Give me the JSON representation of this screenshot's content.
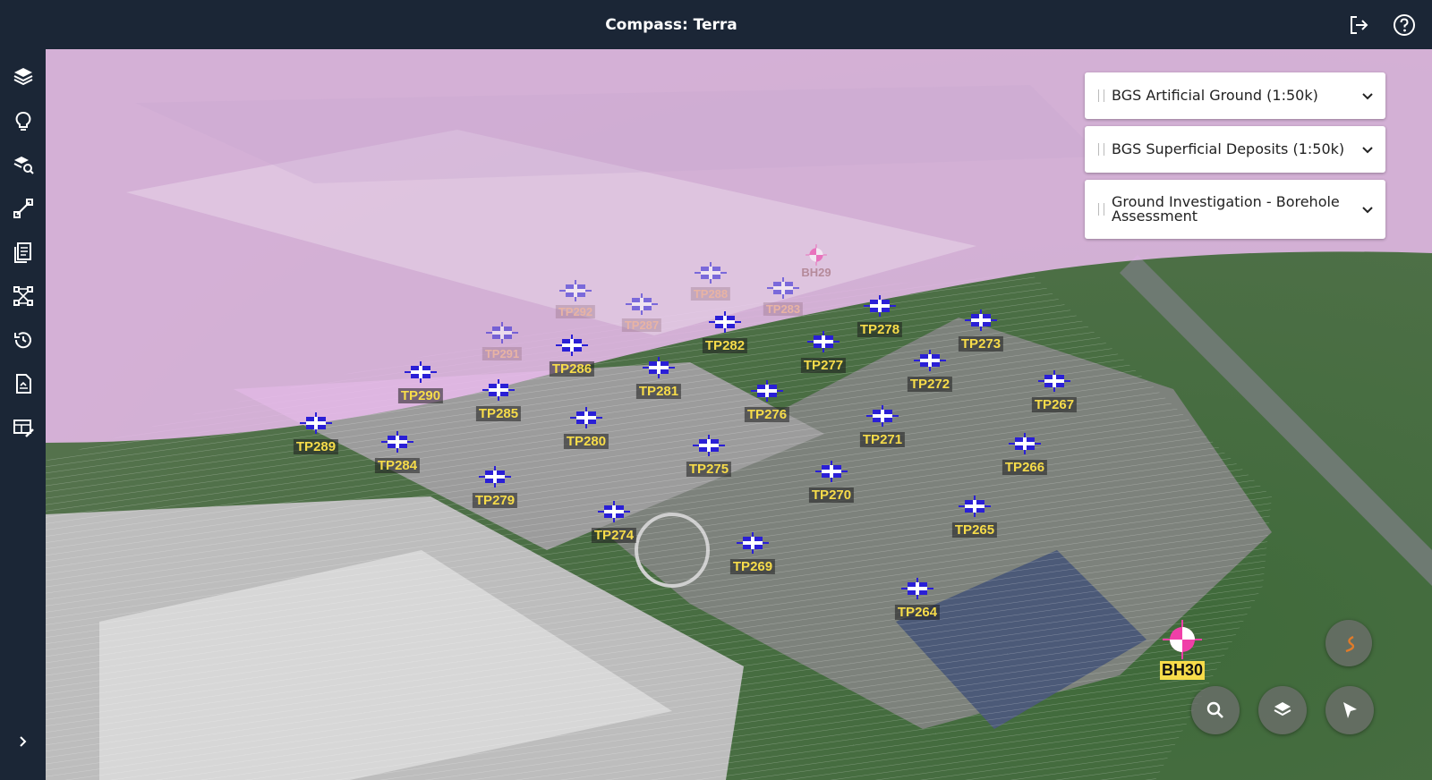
{
  "app": {
    "title": "Compass: Terra"
  },
  "header": {
    "icons": [
      "logout-icon",
      "help-icon"
    ]
  },
  "sidebar": {
    "items": [
      {
        "name": "layers",
        "icon": "layers-icon"
      },
      {
        "name": "insights",
        "icon": "lightbulb-icon"
      },
      {
        "name": "search-area",
        "icon": "search-layers-icon"
      },
      {
        "name": "measure",
        "icon": "ruler-line-icon"
      },
      {
        "name": "documents",
        "icon": "documents-icon"
      },
      {
        "name": "network",
        "icon": "network-icon"
      },
      {
        "name": "history",
        "icon": "history-icon"
      },
      {
        "name": "report",
        "icon": "report-icon"
      },
      {
        "name": "table-edit",
        "icon": "table-edit-icon"
      }
    ],
    "expand_icon": "chevron-right-icon"
  },
  "layers": [
    {
      "title": "BGS Artificial Ground (1:50k)"
    },
    {
      "title": "BGS Superficial Deposits (1:50k)"
    },
    {
      "title": "Ground Investigation - Borehole Assessment"
    }
  ],
  "trial_pits": [
    {
      "label": "TP292",
      "faded": true
    },
    {
      "label": "TP288",
      "faded": true
    },
    {
      "label": "TP283",
      "faded": true
    },
    {
      "label": "TP287",
      "faded": true
    },
    {
      "label": "TP291",
      "faded": true
    },
    {
      "label": "TP286",
      "faded": false
    },
    {
      "label": "TP282",
      "faded": false
    },
    {
      "label": "TP278",
      "faded": false
    },
    {
      "label": "TP273",
      "faded": false
    },
    {
      "label": "TP277",
      "faded": false
    },
    {
      "label": "TP281",
      "faded": false
    },
    {
      "label": "TP290",
      "faded": false
    },
    {
      "label": "TP272",
      "faded": false
    },
    {
      "label": "TP267",
      "faded": false
    },
    {
      "label": "TP285",
      "faded": false
    },
    {
      "label": "TP276",
      "faded": false
    },
    {
      "label": "TP271",
      "faded": false
    },
    {
      "label": "TP289",
      "faded": false
    },
    {
      "label": "TP280",
      "faded": false
    },
    {
      "label": "TP284",
      "faded": false
    },
    {
      "label": "TP275",
      "faded": false
    },
    {
      "label": "TP266",
      "faded": false
    },
    {
      "label": "TP270",
      "faded": false
    },
    {
      "label": "TP279",
      "faded": false
    },
    {
      "label": "TP265",
      "faded": false
    },
    {
      "label": "TP274",
      "faded": false
    },
    {
      "label": "TP269",
      "faded": false
    },
    {
      "label": "TP264",
      "faded": false
    }
  ],
  "boreholes": [
    {
      "label": "BH29",
      "faded": true
    },
    {
      "label": "BH30",
      "faded": false
    }
  ],
  "map_controls": [
    "search-icon",
    "layers-icon",
    "cursor-icon",
    "compass-icon"
  ],
  "colors": {
    "chrome": "#1b2636",
    "overlay_pink": "#e9c2ec",
    "label_yellow": "#f7dc4a",
    "marker_blue": "#2a1fd6",
    "borehole_pink": "#f03fa8"
  }
}
